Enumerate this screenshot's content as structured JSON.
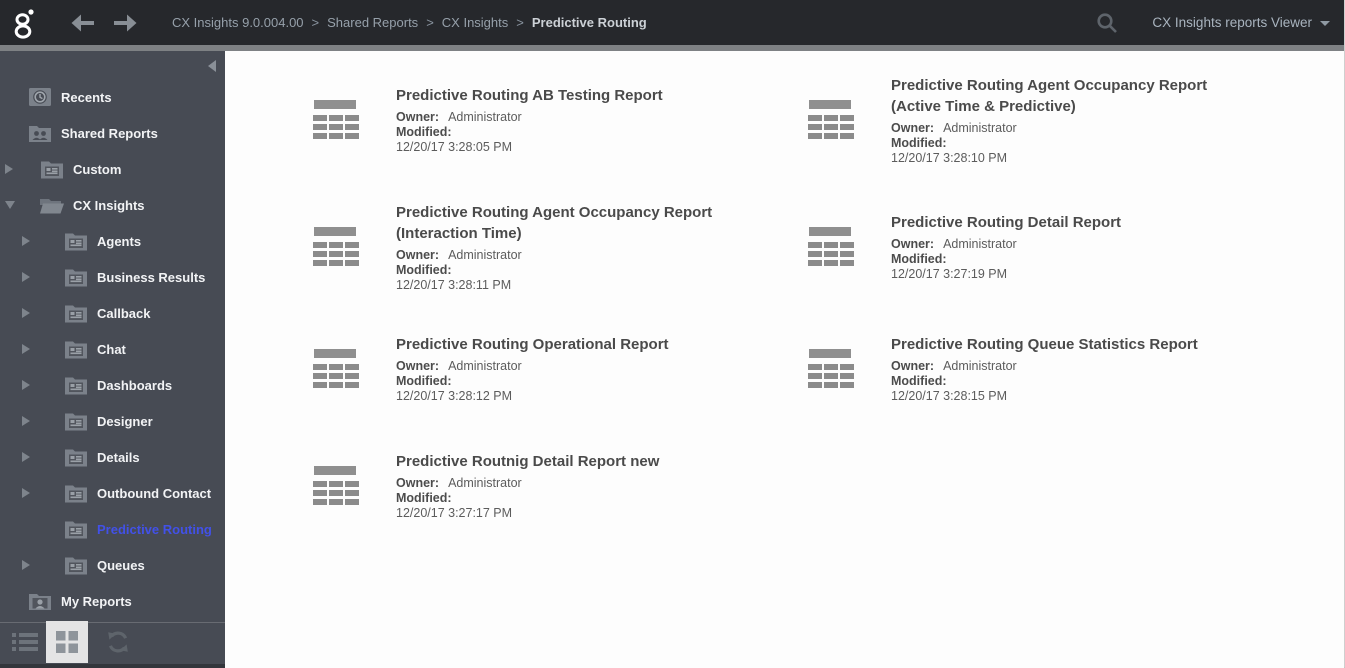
{
  "colors": {
    "selected_item": "#4251e8",
    "header_bg": "#26282c",
    "sidebar_bg": "#474b54"
  },
  "header": {
    "logo_icon": "genesys-logo",
    "breadcrumb": [
      {
        "label": "CX Insights 9.0.004.00"
      },
      {
        "label": "Shared Reports"
      },
      {
        "label": "CX Insights"
      },
      {
        "label": "Predictive Routing"
      }
    ],
    "separator": ">",
    "user_menu_label": "CX Insights reports Viewer"
  },
  "sidebar": {
    "items": [
      {
        "label": "Recents",
        "level": 0,
        "arrow": "none",
        "icon": "recents",
        "selected": false
      },
      {
        "label": "Shared Reports",
        "level": 0,
        "arrow": "none",
        "icon": "shared-reports",
        "selected": false
      },
      {
        "label": "Custom",
        "level": 1,
        "arrow": "right",
        "icon": "report-folder",
        "selected": false
      },
      {
        "label": "CX Insights",
        "level": 1,
        "arrow": "down",
        "icon": "folder-open",
        "selected": false
      },
      {
        "label": "Agents",
        "level": 2,
        "arrow": "right",
        "icon": "report-folder",
        "selected": false
      },
      {
        "label": "Business Results",
        "level": 2,
        "arrow": "right",
        "icon": "report-folder",
        "selected": false
      },
      {
        "label": "Callback",
        "level": 2,
        "arrow": "right",
        "icon": "report-folder",
        "selected": false
      },
      {
        "label": "Chat",
        "level": 2,
        "arrow": "right",
        "icon": "report-folder",
        "selected": false
      },
      {
        "label": "Dashboards",
        "level": 2,
        "arrow": "right",
        "icon": "report-folder",
        "selected": false
      },
      {
        "label": "Designer",
        "level": 2,
        "arrow": "right",
        "icon": "report-folder",
        "selected": false
      },
      {
        "label": "Details",
        "level": 2,
        "arrow": "right",
        "icon": "report-folder",
        "selected": false
      },
      {
        "label": "Outbound Contact",
        "level": 2,
        "arrow": "right",
        "icon": "report-folder",
        "selected": false
      },
      {
        "label": "Predictive Routing",
        "level": 2,
        "arrow": "none",
        "icon": "report-folder",
        "selected": true
      },
      {
        "label": "Queues",
        "level": 2,
        "arrow": "right",
        "icon": "report-folder",
        "selected": false
      },
      {
        "label": "My Reports",
        "level": 0,
        "arrow": "none",
        "icon": "my-reports",
        "selected": false
      }
    ],
    "footer": {
      "buttons": [
        "list-view",
        "grid-view",
        "refresh"
      ],
      "selected_view": "grid-view"
    }
  },
  "reports": {
    "owner_label": "Owner:",
    "modified_label": "Modified:",
    "items": [
      {
        "title": "Predictive Routing AB Testing Report",
        "owner": "Administrator",
        "modified": "12/20/17 3:28:05 PM"
      },
      {
        "title": "Predictive Routing Agent Occupancy Report (Active Time & Predictive)",
        "owner": "Administrator",
        "modified": "12/20/17 3:28:10 PM"
      },
      {
        "title": "Predictive Routing Agent Occupancy Report (Interaction Time)",
        "owner": "Administrator",
        "modified": "12/20/17 3:28:11 PM"
      },
      {
        "title": "Predictive Routing Detail Report",
        "owner": "Administrator",
        "modified": "12/20/17 3:27:19 PM"
      },
      {
        "title": "Predictive Routing Operational Report",
        "owner": "Administrator",
        "modified": "12/20/17 3:28:12 PM"
      },
      {
        "title": "Predictive Routing Queue Statistics Report",
        "owner": "Administrator",
        "modified": "12/20/17 3:28:15 PM"
      },
      {
        "title": "Predictive Routnig Detail Report new",
        "owner": "Administrator",
        "modified": "12/20/17 3:27:17 PM"
      }
    ]
  }
}
